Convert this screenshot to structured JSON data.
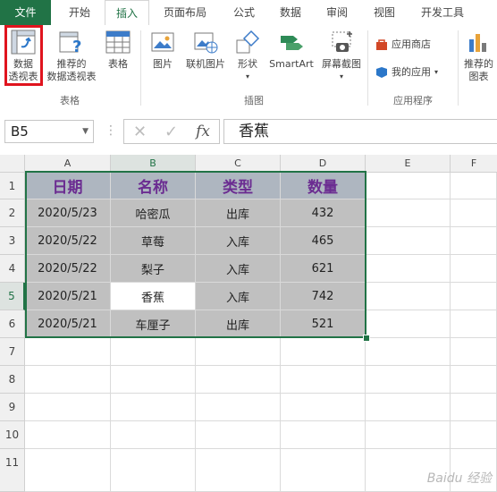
{
  "tabs": [
    {
      "label": "文件"
    },
    {
      "label": "开始"
    },
    {
      "label": "插入"
    },
    {
      "label": "页面布局"
    },
    {
      "label": "公式"
    },
    {
      "label": "数据"
    },
    {
      "label": "审阅"
    },
    {
      "label": "视图"
    },
    {
      "label": "开发工具"
    }
  ],
  "ribbon": {
    "pivot_table_line1": "数据",
    "pivot_table_line2": "透视表",
    "recommended_pivot_line1": "推荐的",
    "recommended_pivot_line2": "数据透视表",
    "table": "表格",
    "group_tables": "表格",
    "picture": "图片",
    "online_picture": "联机图片",
    "shapes": "形状",
    "smartart": "SmartArt",
    "screenshot": "屏幕截图",
    "group_illustrations": "插图",
    "app_store": "应用商店",
    "my_apps": "我的应用",
    "group_apps": "应用程序",
    "recommended_charts_line1": "推荐的",
    "recommended_charts_line2": "图表"
  },
  "formula_bar": {
    "name_box": "B5",
    "fx_label": "fx",
    "content": "香蕉"
  },
  "columns": [
    "A",
    "B",
    "C",
    "D",
    "E",
    "F"
  ],
  "rows": [
    "1",
    "2",
    "3",
    "4",
    "5",
    "6",
    "7",
    "8",
    "9",
    "10",
    "11"
  ],
  "table": {
    "headers": [
      "日期",
      "名称",
      "类型",
      "数量"
    ],
    "rows": [
      [
        "2020/5/23",
        "哈密瓜",
        "出库",
        "432"
      ],
      [
        "2020/5/22",
        "草莓",
        "入库",
        "465"
      ],
      [
        "2020/5/22",
        "梨子",
        "入库",
        "621"
      ],
      [
        "2020/5/21",
        "香蕉",
        "入库",
        "742"
      ],
      [
        "2020/5/21",
        "车厘子",
        "出库",
        "521"
      ]
    ]
  },
  "watermark": "Baidu 经验",
  "colors": {
    "accent": "#217346",
    "header_fill": "#aeb6c0",
    "header_text": "#6b2c91",
    "data_fill": "#c0c0c0",
    "highlight": "#e0141e"
  }
}
